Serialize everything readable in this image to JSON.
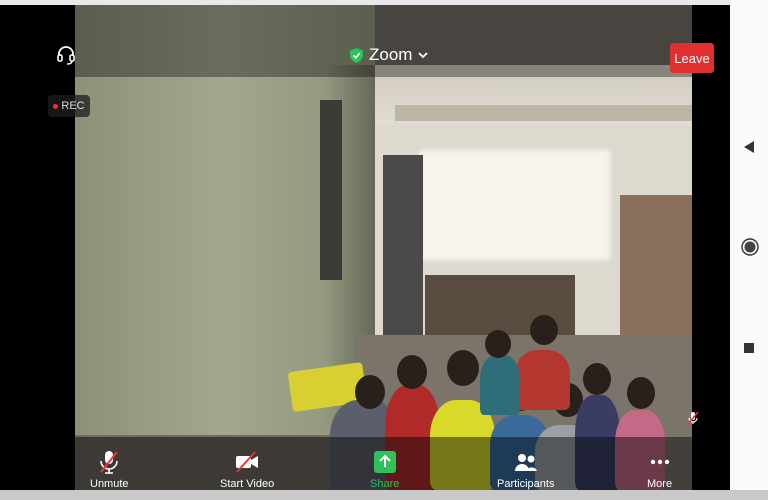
{
  "header": {
    "app_name": "Zoom",
    "leave_label": "Leave",
    "rec_label": "REC",
    "leave_color": "#e02f2f",
    "shield_color": "#2fc15a"
  },
  "toolbar": {
    "unmute_label": "Unmute",
    "start_video_label": "Start Video",
    "share_label": "Share",
    "participants_label": "Participants",
    "more_label": "More",
    "share_color": "#2fc15a"
  },
  "icons": {
    "headset": "headset-icon",
    "shield": "shield-icon",
    "chevron": "chevron-down-icon",
    "mic_muted": "mic-muted-icon",
    "video_off": "video-off-icon",
    "share": "share-up-icon",
    "participants": "participants-icon",
    "more": "more-dots-icon",
    "back": "back-triangle-icon",
    "home": "home-circle-icon",
    "recents": "recents-square-icon"
  }
}
